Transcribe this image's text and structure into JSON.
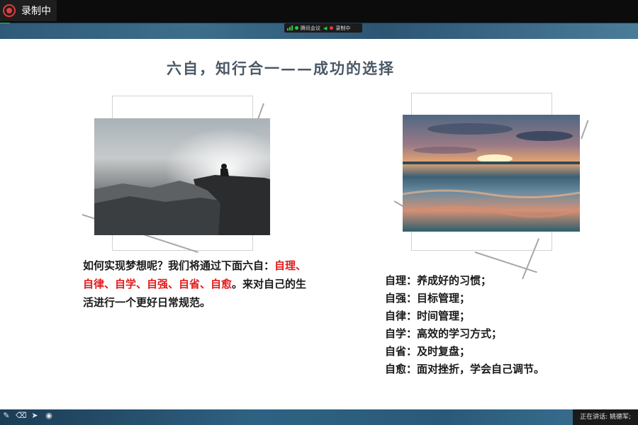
{
  "recording": {
    "label": "录制中"
  },
  "meeting_bar": {
    "app_name": "腾讯会议",
    "recording_label": "录制中"
  },
  "slide": {
    "title": "六自，知行合一——成功的选择",
    "left_paragraph": {
      "before": "如何实现梦想呢？我们将通过下面六自：",
      "highlight": "自理、自律、自学、自强、自省、自愈",
      "after": "。来对自己的生活进行一个更好日常规范。"
    },
    "list": [
      {
        "term": "自理",
        "sep": "：",
        "desc": "养成好的习惯；"
      },
      {
        "term": "自强",
        "sep": "：",
        "desc": "目标管理；"
      },
      {
        "term": "自律",
        "sep": "：",
        "desc": "时间管理；"
      },
      {
        "term": "自学",
        "sep": "：",
        "desc": "高效的学习方式；"
      },
      {
        "term": "自省",
        "sep": "：",
        "desc": "及时复盘；"
      },
      {
        "term": "自愈",
        "sep": "：",
        "desc": "面对挫折，学会自己调节。"
      }
    ]
  },
  "bottom_bar": {
    "tools": [
      "pen-icon",
      "eraser-icon",
      "pointer-icon",
      "record-circle-icon"
    ],
    "speaking_label": "正在讲话: 姚德军;"
  },
  "colors": {
    "accent_red": "#e21c1c",
    "title_gray": "#4a5866",
    "rec_red": "#e23c3c",
    "signal_green": "#2ecc40"
  }
}
